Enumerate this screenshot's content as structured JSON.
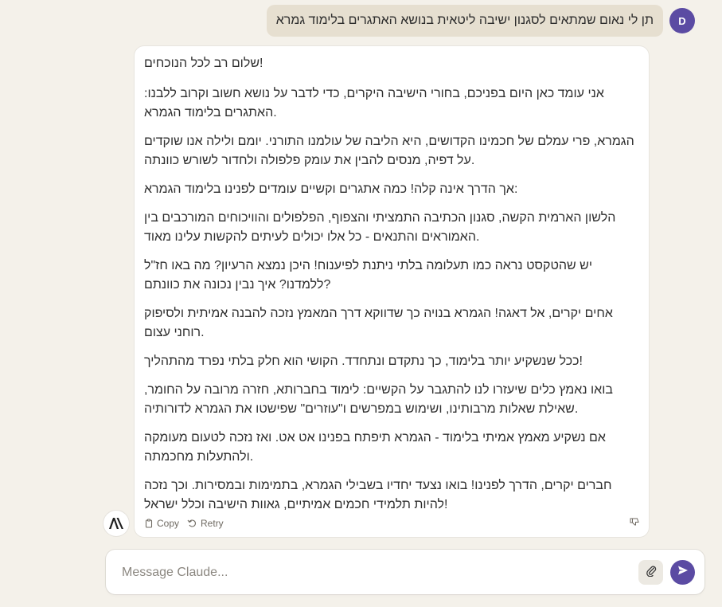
{
  "user": {
    "avatar_initial": "D",
    "message": "תן לי נאום שמתאים לסגנון ישיבה ליטאית בנושא האתגרים בלימוד גמרא"
  },
  "assistant": {
    "paragraphs": [
      "שלום רב לכל הנוכחים!",
      "אני עומד כאן היום בפניכם, בחורי הישיבה היקרים, כדי לדבר על נושא חשוב וקרוב ללבנו: האתגרים בלימוד הגמרא.",
      "הגמרא, פרי עמלם של חכמינו הקדושים, היא הליבה של עולמנו התורני. יומם ולילה אנו שוקדים על דפיה, מנסים להבין את עומק פלפולה ולחדור לשורש כוונתה.",
      "אך הדרך אינה קלה! כמה אתגרים וקשיים עומדים לפנינו בלימוד הגמרא:",
      "הלשון הארמית הקשה, סגנון הכתיבה התמציתי והצפוף, הפלפולים והוויכוחים המורכבים בין האמוראים והתנאים - כל אלו יכולים לעיתים להקשות עלינו מאוד.",
      "יש שהטקסט נראה כמו תעלומה בלתי ניתנת לפיענוח! היכן נמצא הרעיון? מה באו חז\"ל ללמדנו? איך נבין נכונה את כוונתם?",
      "אחים יקרים, אל דאגה! הגמרא בנויה כך שדווקא דרך המאמץ נזכה להבנה אמיתית ולסיפוק רוחני עצום.",
      "ככל שנשקיע יותר בלימוד, כך נתקדם ונתחדד. הקושי הוא חלק בלתי נפרד מהתהליך!",
      "בואו נאמץ כלים שיעזרו לנו להתגבר על הקשיים: לימוד בחברותא, חזרה מרובה על החומר, שאילת שאלות מרבותינו, ושימוש במפרשים ו\"עוזרים\" שפישטו את הגמרא לדורותיה.",
      "אם נשקיע מאמץ אמיתי בלימוד - הגמרא תיפתח בפנינו אט אט. ואז נזכה לטעום מעומקה ולהתעלות מחכמתה.",
      "חברים יקרים, הדרך לפנינו! בואו נצעד יחדיו בשבילי הגמרא, בתמימות ובמסירות. וכך נזכה להיות תלמידי חכמים אמיתיים, גאוות הישיבה וכלל ישראל!"
    ],
    "copy_label": "Copy",
    "retry_label": "Retry"
  },
  "composer": {
    "placeholder": "Message Claude..."
  },
  "colors": {
    "background": "#f4f1ea",
    "user_bubble": "#e6dfd0",
    "accent": "#5b4ba3"
  },
  "icons": [
    "copy-icon",
    "retry-icon",
    "thumbs-down-icon",
    "claude-logo-icon",
    "paperclip-icon",
    "send-arrow-icon"
  ]
}
